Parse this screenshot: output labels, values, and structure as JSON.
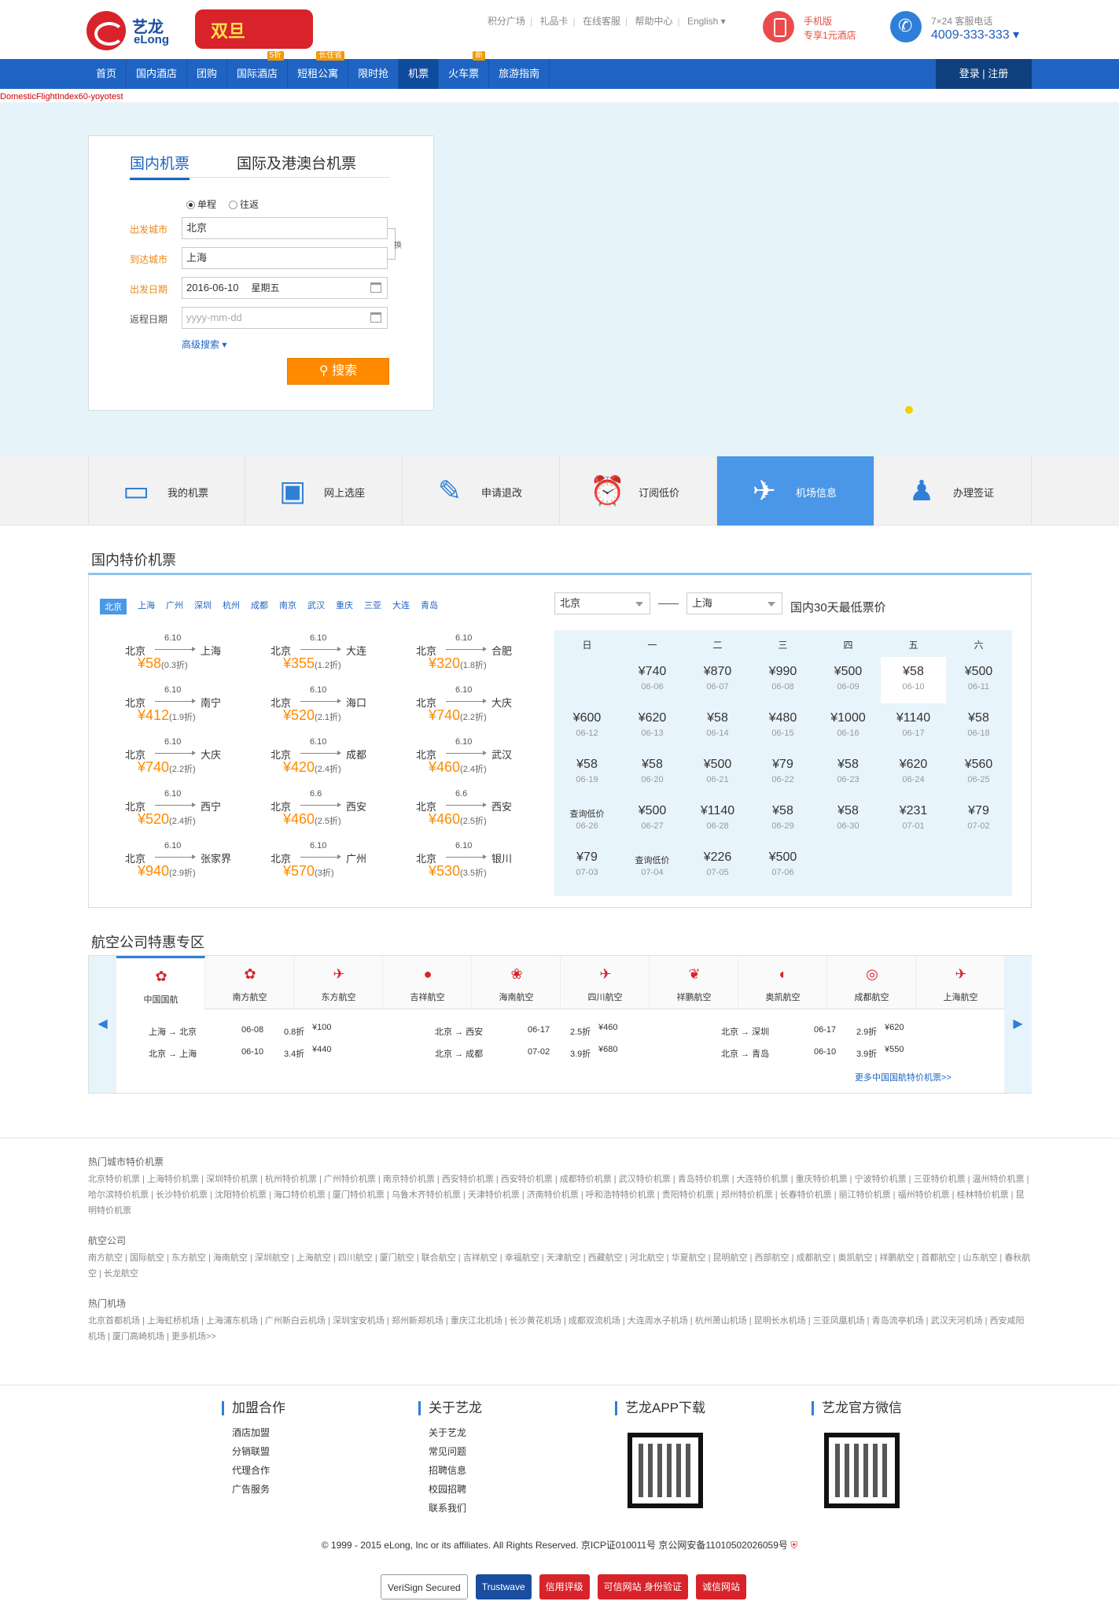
{
  "header": {
    "logo_cn": "艺龙",
    "logo_en": "eLong",
    "promo": "双旦",
    "toplinks": [
      "积分广场",
      "礼品卡",
      "在线客服",
      "帮助中心",
      "English ▾"
    ],
    "mobile": {
      "title": "手机版",
      "sub": "专享1元酒店"
    },
    "phone": {
      "title": "7×24 客服电话",
      "number": "4009-333-333 ▾"
    }
  },
  "nav": {
    "items": [
      {
        "label": "首页",
        "badge": ""
      },
      {
        "label": "国内酒店",
        "badge": ""
      },
      {
        "label": "团购",
        "badge": ""
      },
      {
        "label": "国际酒店",
        "badge": "5折"
      },
      {
        "label": "短租公寓",
        "badge": "长住省"
      },
      {
        "label": "限时抢",
        "badge": ""
      },
      {
        "label": "机票",
        "badge": ""
      },
      {
        "label": "火车票",
        "badge": "新"
      },
      {
        "label": "旅游指南",
        "badge": ""
      }
    ],
    "login": "登录 | 注册"
  },
  "debug_text": "DomesticFlightIndex60-yoyotest",
  "search": {
    "tab_domestic": "国内机票",
    "tab_intl": "国际及港澳台机票",
    "oneway": "单程",
    "roundtrip": "往返",
    "depart_label": "出发城市",
    "depart_value": "北京",
    "arrive_label": "到达城市",
    "arrive_value": "上海",
    "swap": "换",
    "date_label": "出发日期",
    "date_value": "2016-06-10",
    "date_weekday": "星期五",
    "return_label": "返程日期",
    "return_placeholder": "yyyy-mm-dd",
    "advanced": "高级搜索 ▾",
    "button": "搜索"
  },
  "services": [
    "我的机票",
    "网上选座",
    "申请退改",
    "订阅低价",
    "机场信息",
    "办理签证"
  ],
  "deals": {
    "title": "国内特价机票",
    "city_tabs": [
      "北京",
      "上海",
      "广州",
      "深圳",
      "杭州",
      "成都",
      "南京",
      "武汉",
      "重庆",
      "三亚",
      "大连",
      "青岛"
    ],
    "items": [
      {
        "from": "北京",
        "date": "6.10",
        "to": "上海",
        "price": "¥58",
        "disc": "(0.3折)"
      },
      {
        "from": "北京",
        "date": "6.10",
        "to": "大连",
        "price": "¥355",
        "disc": "(1.2折)"
      },
      {
        "from": "北京",
        "date": "6.10",
        "to": "合肥",
        "price": "¥320",
        "disc": "(1.8折)"
      },
      {
        "from": "北京",
        "date": "6.10",
        "to": "南宁",
        "price": "¥412",
        "disc": "(1.9折)"
      },
      {
        "from": "北京",
        "date": "6.10",
        "to": "海口",
        "price": "¥520",
        "disc": "(2.1折)"
      },
      {
        "from": "北京",
        "date": "6.10",
        "to": "大庆",
        "price": "¥740",
        "disc": "(2.2折)"
      },
      {
        "from": "北京",
        "date": "6.10",
        "to": "大庆",
        "price": "¥740",
        "disc": "(2.2折)"
      },
      {
        "from": "北京",
        "date": "6.10",
        "to": "成都",
        "price": "¥420",
        "disc": "(2.4折)"
      },
      {
        "from": "北京",
        "date": "6.10",
        "to": "武汉",
        "price": "¥460",
        "disc": "(2.4折)"
      },
      {
        "from": "北京",
        "date": "6.10",
        "to": "西宁",
        "price": "¥520",
        "disc": "(2.4折)"
      },
      {
        "from": "北京",
        "date": "6.6",
        "to": "西安",
        "price": "¥460",
        "disc": "(2.5折)"
      },
      {
        "from": "北京",
        "date": "6.6",
        "to": "西安",
        "price": "¥460",
        "disc": "(2.5折)"
      },
      {
        "from": "北京",
        "date": "6.10",
        "to": "张家界",
        "price": "¥940",
        "disc": "(2.9折)"
      },
      {
        "from": "北京",
        "date": "6.10",
        "to": "广州",
        "price": "¥570",
        "disc": "(3折)"
      },
      {
        "from": "北京",
        "date": "6.10",
        "to": "银川",
        "price": "¥530",
        "disc": "(3.5折)"
      }
    ],
    "cal_from": "北京",
    "cal_to": "上海",
    "cal_title": "国内30天最低票价",
    "weekdays": [
      "日",
      "一",
      "二",
      "三",
      "四",
      "五",
      "六"
    ],
    "cells": [
      {
        "p": "",
        "d": ""
      },
      {
        "p": "¥740",
        "d": "06-06"
      },
      {
        "p": "¥870",
        "d": "06-07"
      },
      {
        "p": "¥990",
        "d": "06-08"
      },
      {
        "p": "¥500",
        "d": "06-09"
      },
      {
        "p": "¥58",
        "d": "06-10"
      },
      {
        "p": "¥500",
        "d": "06-11"
      },
      {
        "p": "¥600",
        "d": "06-12"
      },
      {
        "p": "¥620",
        "d": "06-13"
      },
      {
        "p": "¥58",
        "d": "06-14"
      },
      {
        "p": "¥480",
        "d": "06-15"
      },
      {
        "p": "¥1000",
        "d": "06-16"
      },
      {
        "p": "¥1140",
        "d": "06-17"
      },
      {
        "p": "¥58",
        "d": "06-18"
      },
      {
        "p": "¥58",
        "d": "06-19"
      },
      {
        "p": "¥58",
        "d": "06-20"
      },
      {
        "p": "¥500",
        "d": "06-21"
      },
      {
        "p": "¥79",
        "d": "06-22"
      },
      {
        "p": "¥58",
        "d": "06-23"
      },
      {
        "p": "¥620",
        "d": "06-24"
      },
      {
        "p": "¥560",
        "d": "06-25"
      },
      {
        "p": "查询低价",
        "d": "06-26"
      },
      {
        "p": "¥500",
        "d": "06-27"
      },
      {
        "p": "¥1140",
        "d": "06-28"
      },
      {
        "p": "¥58",
        "d": "06-29"
      },
      {
        "p": "¥58",
        "d": "06-30"
      },
      {
        "p": "¥231",
        "d": "07-01"
      },
      {
        "p": "¥79",
        "d": "07-02"
      },
      {
        "p": "¥79",
        "d": "07-03"
      },
      {
        "p": "查询低价",
        "d": "07-04"
      },
      {
        "p": "¥226",
        "d": "07-05"
      },
      {
        "p": "¥500",
        "d": "07-06"
      },
      {
        "p": "",
        "d": ""
      },
      {
        "p": "",
        "d": ""
      },
      {
        "p": "",
        "d": ""
      }
    ]
  },
  "airlines": {
    "title": "航空公司特惠专区",
    "tabs": [
      "中国国航",
      "南方航空",
      "东方航空",
      "吉祥航空",
      "海南航空",
      "四川航空",
      "祥鹏航空",
      "奥凯航空",
      "成都航空",
      "上海航空"
    ],
    "flights": [
      {
        "route": "上海 → 北京",
        "date": "06-08",
        "disc": "0.8折",
        "price": "¥100"
      },
      {
        "route": "北京 → 上海",
        "date": "06-10",
        "disc": "3.4折",
        "price": "¥440"
      },
      {
        "route": "北京 → 西安",
        "date": "06-17",
        "disc": "2.5折",
        "price": "¥460"
      },
      {
        "route": "北京 → 成都",
        "date": "07-02",
        "disc": "3.9折",
        "price": "¥680"
      },
      {
        "route": "北京 → 深圳",
        "date": "06-17",
        "disc": "2.9折",
        "price": "¥620"
      },
      {
        "route": "北京 → 青岛",
        "date": "06-10",
        "disc": "3.9折",
        "price": "¥550"
      }
    ],
    "more": "更多中国国航特价机票>>"
  },
  "links": {
    "city_title": "热门城市特价机票",
    "city_text": "北京特价机票 | 上海特价机票 | 深圳特价机票 | 杭州特价机票 | 广州特价机票 | 南京特价机票 | 西安特价机票 | 西安特价机票 | 成都特价机票 | 武汉特价机票 | 青岛特价机票 | 大连特价机票 | 重庆特价机票 | 宁波特价机票 | 三亚特价机票 | 温州特价机票 | 哈尔滨特价机票 | 长沙特价机票 | 沈阳特价机票 | 海口特价机票 | 厦门特价机票 | 乌鲁木齐特价机票 | 天津特价机票 | 济南特价机票 | 呼和浩特特价机票 | 贵阳特价机票 | 郑州特价机票 | 长春特价机票 | 丽江特价机票 | 福州特价机票 | 桂林特价机票 | 昆明特价机票",
    "air_title": "航空公司",
    "air_text": "南方航空 | 国际航空 | 东方航空 | 海南航空 | 深圳航空 | 上海航空 | 四川航空 | 厦门航空 | 联合航空 | 吉祥航空 | 幸福航空 | 天津航空 | 西藏航空 | 河北航空 | 华夏航空 | 昆明航空 | 西部航空 | 成都航空 | 奥凯航空 | 祥鹏航空 | 首都航空 | 山东航空 | 春秋航空 | 长龙航空",
    "airport_title": "热门机场",
    "airport_text": "北京首都机场 | 上海虹桥机场 | 上海浦东机场 | 广州新白云机场 | 深圳宝安机场 | 郑州新郑机场 | 重庆江北机场 | 长沙黄花机场 | 成都双流机场 | 大连周水子机场 | 杭州萧山机场 | 昆明长水机场 | 三亚凤凰机场 | 青岛流亭机场 | 武汉天河机场 | 西安咸阳机场 | 厦门高崎机场 | 更多机场>>"
  },
  "footer": {
    "col1_title": "加盟合作",
    "col1": [
      "酒店加盟",
      "分销联盟",
      "代理合作",
      "广告服务"
    ],
    "col2_title": "关于艺龙",
    "col2": [
      "关于艺龙",
      "常见问题",
      "招聘信息",
      "校园招聘",
      "联系我们"
    ],
    "col3_title": "艺龙APP下载",
    "col4_title": "艺龙官方微信",
    "copyright": "© 1999 - 2015 eLong, Inc or its affiliates. All Rights Reserved. 京ICP证010011号 京公网安备11010502026059号",
    "badges": [
      "VeriSign Secured",
      "Trustwave",
      "信用评级",
      "可信网站 身份验证",
      "诚信网站"
    ]
  }
}
